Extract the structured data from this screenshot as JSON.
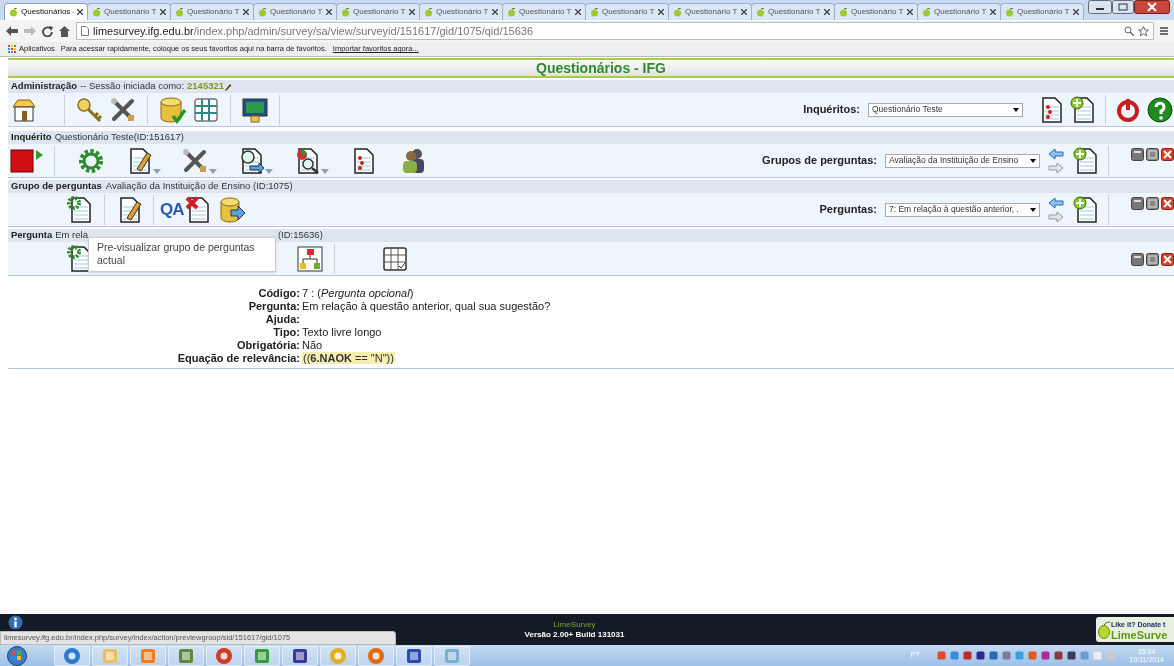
{
  "browser": {
    "tabs": [
      {
        "label": "Questionários -",
        "selected": true
      },
      {
        "label": "Questionário T",
        "selected": false
      },
      {
        "label": "Questionário T",
        "selected": false
      },
      {
        "label": "Questionário T",
        "selected": false
      },
      {
        "label": "Questionário T",
        "selected": false
      },
      {
        "label": "Questionário T",
        "selected": false
      },
      {
        "label": "Questionário T",
        "selected": false
      },
      {
        "label": "Questionário T",
        "selected": false
      },
      {
        "label": "Questionário T",
        "selected": false
      },
      {
        "label": "Questionário T",
        "selected": false
      },
      {
        "label": "Questionário T",
        "selected": false
      },
      {
        "label": "Questionário T",
        "selected": false
      },
      {
        "label": "Questionário T",
        "selected": false
      }
    ],
    "address": {
      "host": "limesurvey.ifg.edu.br",
      "path": "/index.php/admin/survey/sa/view/surveyid/151617/gid/1075/qid/15636"
    },
    "bookmarks": {
      "apps": "Aplicativos",
      "hint": "Para acessar rapidamente, coloque os seus favoritos aqui na barra de favoritos.",
      "link": "Importar favoritos agora..."
    }
  },
  "page_title": "Questionários - IFG",
  "admin": {
    "title": "Administração",
    "session": "-- Sessão iniciada como:",
    "user": "2145321",
    "selector_label": "Inquéritos:",
    "selector_value": "Questionário Teste"
  },
  "survey": {
    "title": "Inquérito",
    "name": "Questionário Teste(ID:151617)",
    "selector_label": "Grupos de perguntas:",
    "selector_value": "Avaliação da Instituição de Ensino"
  },
  "group": {
    "title": "Grupo de perguntas",
    "name": "Avaliação da Instituição de Ensino (ID:1075)",
    "qa_label": "QA",
    "selector_label": "Perguntas:",
    "selector_value": "7: Em relação à questão anterior, ."
  },
  "question": {
    "title": "Pergunta",
    "name_start": "Em rela",
    "name_end": "(ID:15636)"
  },
  "tooltip": "Pre-visualizar grupo de perguntas actual",
  "details": [
    {
      "label": "Código:",
      "value": "7 : (*Pergunta opcional*)",
      "kind": "text"
    },
    {
      "label": "Pergunta:",
      "value": "Em relação à questão anterior, qual sua sugestão?",
      "kind": "text"
    },
    {
      "label": "Ajuda:",
      "kind": "text"
    },
    {
      "label": "Tipo:",
      "value": "Texto livre longo",
      "kind": "text"
    },
    {
      "label": "Obrigatória:",
      "value": "Não",
      "kind": "text"
    },
    {
      "label": "Equação de relevância:",
      "value": "((**6.NAOK** == \"N\"))",
      "kind": "expression"
    }
  ],
  "footer": {
    "brand": "LimeSurvey",
    "version": "Versão 2.00+ Build 131031",
    "donate_top": "Like it? Donate t",
    "donate_brand": "LimeSurve"
  },
  "status_url": "limesurvey.ifg.edu.br/index.php/survey/index/action/previewgroup/sid/151617/gid/1075",
  "taskbar": {
    "language": "PT",
    "time": "15:24",
    "date": "10/11/2014"
  }
}
